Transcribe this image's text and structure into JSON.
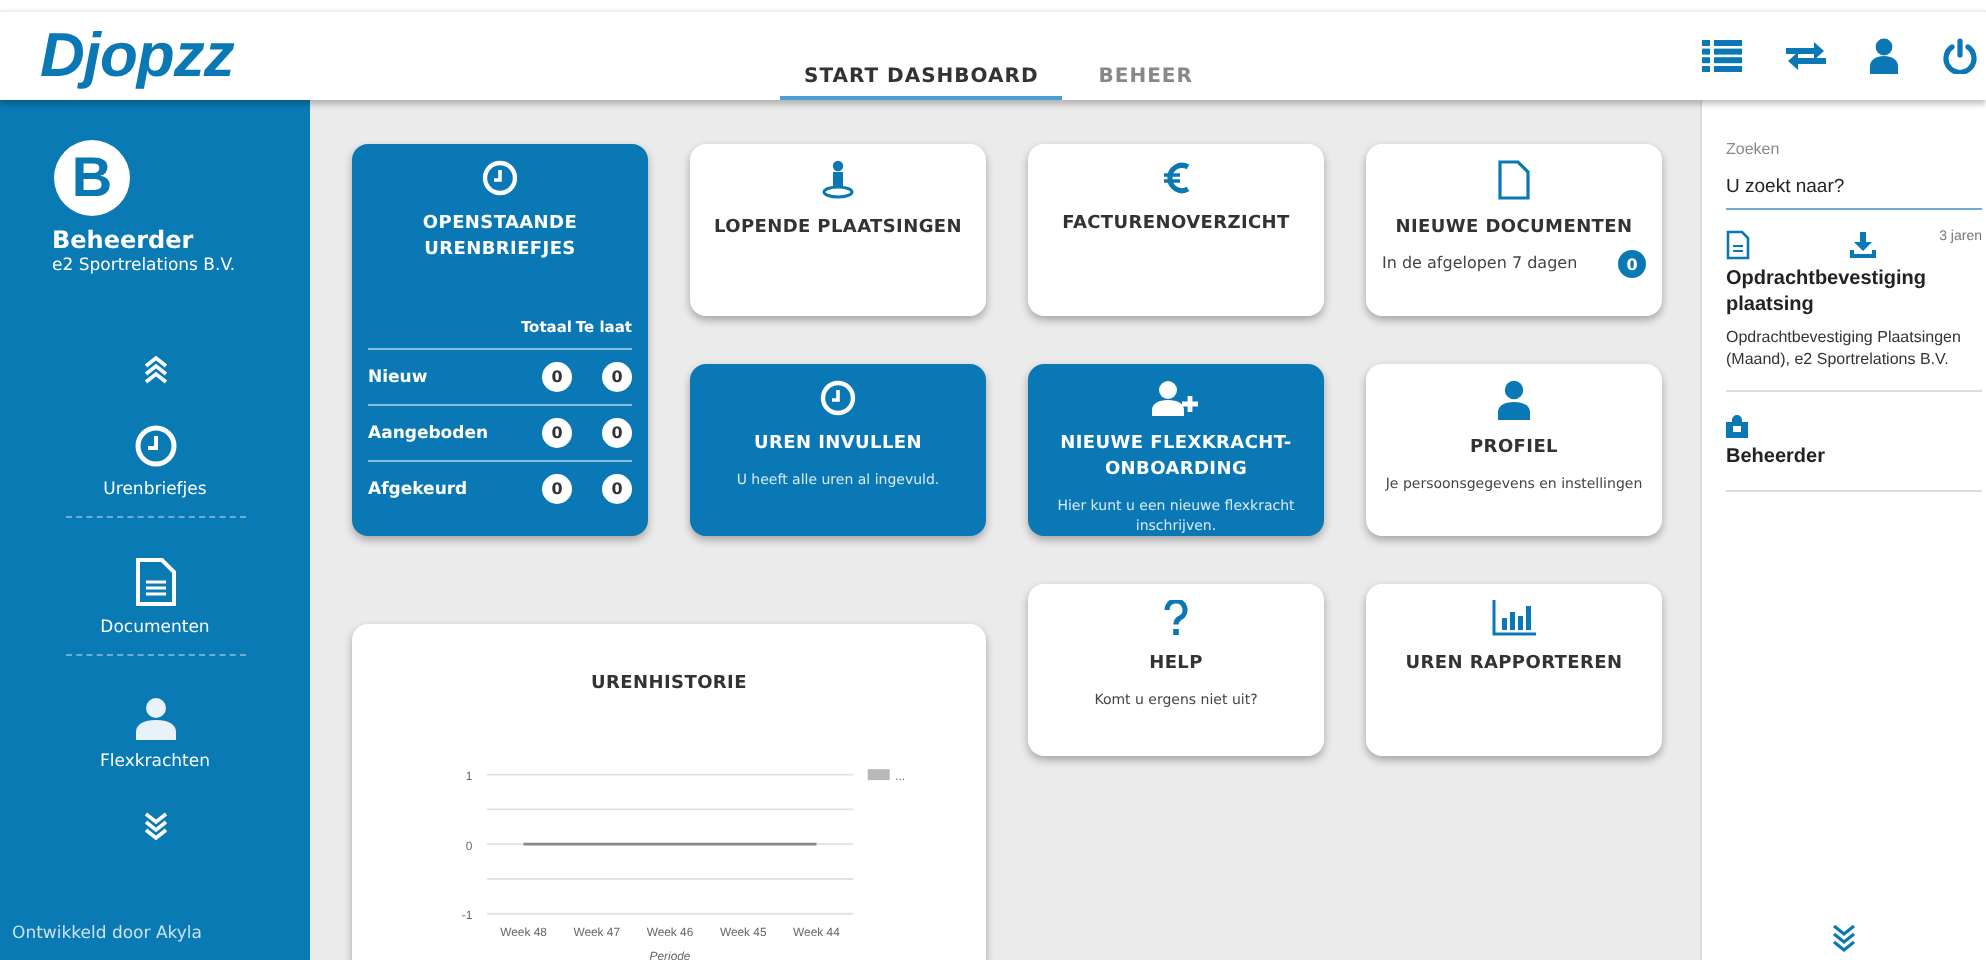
{
  "header": {
    "logo": "Djopzz",
    "tabs": [
      {
        "label": "START DASHBOARD",
        "selected": true
      },
      {
        "label": "BEHEER",
        "selected": false
      }
    ]
  },
  "sidebar": {
    "avatar_letter": "B",
    "user_name": "Beheerder",
    "company": "e2 Sportrelations B.V.",
    "items": [
      {
        "label": "Urenbriefjes"
      },
      {
        "label": "Documenten"
      },
      {
        "label": "Flexkrachten"
      }
    ],
    "footer": "Ontwikkeld door Akyla"
  },
  "tiles": [
    {
      "kind": "hours_table",
      "highlighted": true,
      "title": "OPENSTAANDE URENBRIEFJES",
      "columns": [
        "Totaal",
        "Te laat"
      ],
      "rows": [
        {
          "label": "Nieuw",
          "values": [
            "0",
            "0"
          ]
        },
        {
          "label": "Aangeboden",
          "values": [
            "0",
            "0"
          ]
        },
        {
          "label": "Afgekeurd",
          "values": [
            "0",
            "0"
          ]
        }
      ]
    },
    {
      "kind": "plain",
      "highlighted": false,
      "title": "LOPENDE PLAATSINGEN"
    },
    {
      "kind": "plain",
      "highlighted": false,
      "title": "FACTURENOVERZICHT"
    },
    {
      "kind": "counter",
      "highlighted": false,
      "title": "NIEUWE DOCUMENTEN",
      "text": "In de afgelopen 7 dagen",
      "count": "0"
    },
    {
      "kind": "plain",
      "highlighted": true,
      "title": "UREN INVULLEN",
      "text": "U heeft alle uren al ingevuld."
    },
    {
      "kind": "plain",
      "highlighted": true,
      "title": "NIEUWE FLEXKRACHT-ONBOARDING",
      "text": "Hier kunt u een nieuwe flexkracht inschrijven."
    },
    {
      "kind": "plain",
      "highlighted": false,
      "title": "PROFIEL",
      "text": "Je persoonsgegevens en instellingen"
    },
    {
      "kind": "chart",
      "highlighted": false,
      "title": "URENHISTORIE",
      "chart_data": {
        "type": "line",
        "xlabel": "Periode",
        "categories": [
          "Week 48",
          "Week 47",
          "Week 46",
          "Week 45",
          "Week 44"
        ],
        "series": [
          {
            "name": "...",
            "color": "#888888",
            "values": [
              0,
              0,
              0,
              0,
              0
            ]
          }
        ],
        "ylim": [
          -1,
          1
        ],
        "yticks": [
          -1,
          0,
          1
        ]
      }
    },
    {
      "kind": "plain",
      "highlighted": false,
      "title": "HELP",
      "text": "Komt u ergens niet uit?"
    },
    {
      "kind": "plain",
      "highlighted": false,
      "title": "UREN RAPPORTEREN"
    }
  ],
  "search_panel": {
    "label": "Zoeken",
    "placeholder": "U zoekt naar?",
    "results": [
      {
        "kind": "document",
        "age": "3 jaren",
        "title": "Opdrachtbevestiging plaatsing",
        "description": "Opdrachtbevestiging Plaatsingen (Maand), e2 Sportrelations B.V."
      },
      {
        "kind": "user",
        "title": "Beheerder"
      }
    ]
  }
}
